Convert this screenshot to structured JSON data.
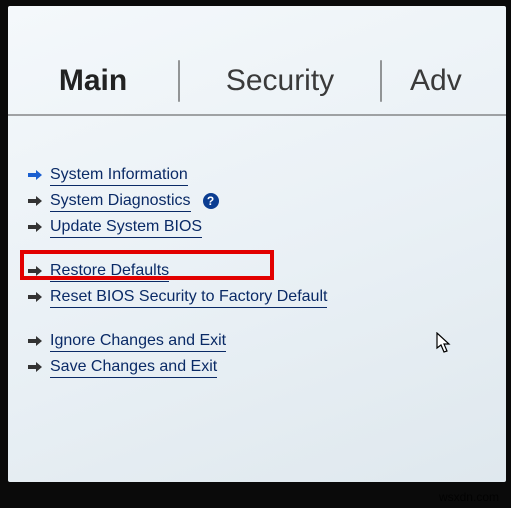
{
  "tabs": {
    "main": "Main",
    "security": "Security",
    "advanced": "Adv"
  },
  "menu": {
    "system_information": "System Information",
    "system_diagnostics": "System Diagnostics",
    "update_system_bios": "Update System BIOS",
    "restore_defaults": "Restore Defaults",
    "reset_bios_security": "Reset BIOS Security to Factory Default",
    "ignore_changes_exit": "Ignore Changes and Exit",
    "save_changes_exit": "Save Changes and Exit"
  },
  "help_symbol": "?",
  "arrow_colors": {
    "selected": "#1a5fd0",
    "normal": "#333333"
  },
  "watermark": "wsxdn.com"
}
